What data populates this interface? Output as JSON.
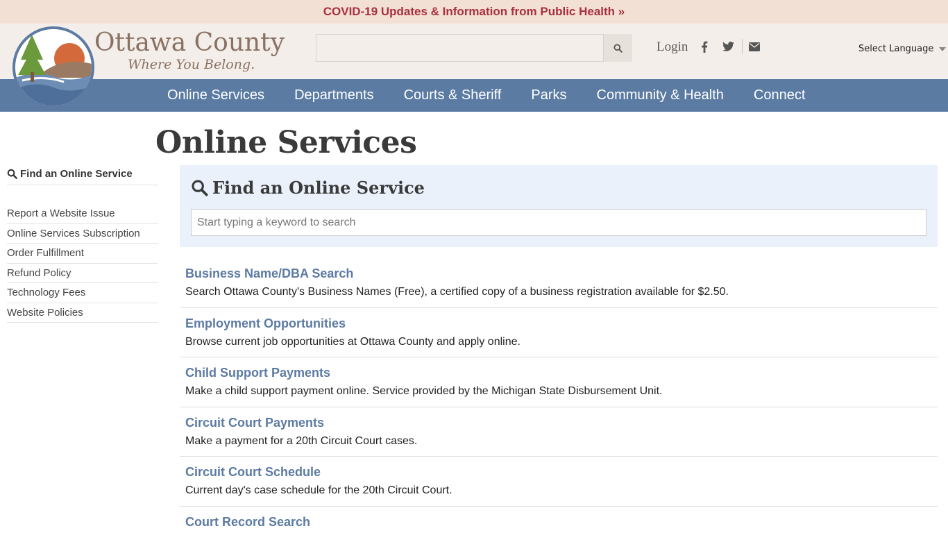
{
  "alert": {
    "text": "COVID-19 Updates & Information from Public Health »"
  },
  "logo": {
    "title": "Ottawa County",
    "tagline": "Where You Belong."
  },
  "header": {
    "search_value": "",
    "login_label": "Login",
    "language_label": "Select Language",
    "social_icons": [
      "facebook-icon",
      "twitter-icon",
      "email-icon"
    ]
  },
  "nav": {
    "items": [
      "Online Services",
      "Departments",
      "Courts & Sheriff",
      "Parks",
      "Community & Health",
      "Connect"
    ]
  },
  "page": {
    "title": "Online Services"
  },
  "sidebar": {
    "find_label": "Find an Online Service",
    "links": [
      "Report a Website Issue",
      "Online Services Subscription",
      "Order Fulfillment",
      "Refund Policy",
      "Technology Fees",
      "Website Policies"
    ]
  },
  "finder": {
    "heading": "Find an Online Service",
    "placeholder": "Start typing a keyword to search"
  },
  "services": [
    {
      "title": "Business Name/DBA Search",
      "desc": "Search Ottawa County's Business Names (Free), a certified copy of a business registration available for $2.50."
    },
    {
      "title": "Employment Opportunities",
      "desc": "Browse current job opportunities at Ottawa County and apply online."
    },
    {
      "title": "Child Support Payments",
      "desc": "Make a child support payment online. Service provided by the Michigan State Disbursement Unit."
    },
    {
      "title": "Circuit Court Payments",
      "desc": "Make a payment for a 20th Circuit Court cases."
    },
    {
      "title": "Circuit Court Schedule",
      "desc": "Current day's case schedule for the 20th Circuit Court."
    },
    {
      "title": "Court Record Search",
      "desc": ""
    }
  ],
  "colors": {
    "alert_bg": "#f2e0d5",
    "alert_text": "#a8303d",
    "nav_bg": "#5b7ba2",
    "link": "#5c7aa3",
    "panel_bg": "#eaf1fa"
  }
}
